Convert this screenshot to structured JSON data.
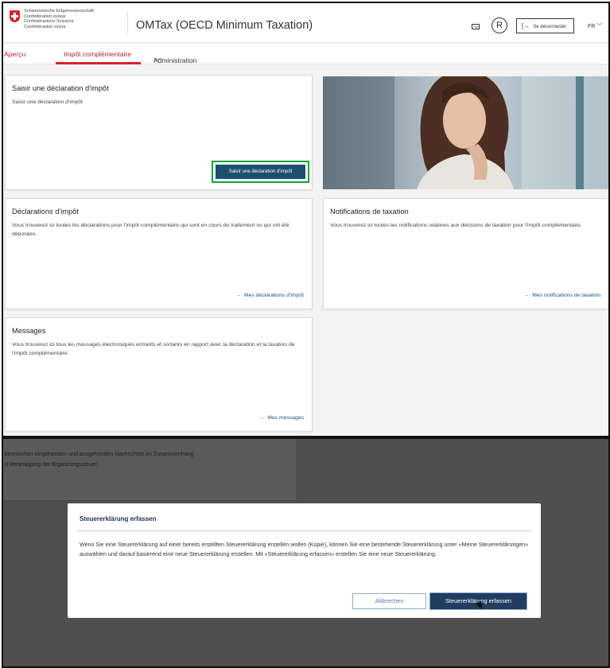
{
  "header": {
    "confederation_lines": [
      "Schweizerische Eidgenossenschaft",
      "Confédération suisse",
      "Confederazione Svizzera",
      "Confederaziun svizra"
    ],
    "app_title": "OMTax (OECD Minimum Taxation)",
    "avatar_letter": "R",
    "login_label": "Se déconnecter",
    "language": "FR"
  },
  "nav": {
    "tabs": [
      {
        "label": "Aperçu"
      },
      {
        "label": "Impôt complémentaire"
      },
      {
        "label": "Administration"
      }
    ]
  },
  "cards": {
    "create": {
      "title": "Saisir une déclaration d'impôt",
      "text": "Saisir une déclaration d'impôt",
      "button": "Saisir une déclaration d'impôt"
    },
    "declarations": {
      "title": "Déclarations d'impôt",
      "text": "Vous trouverez ici toutes les déclarations pour l'impôt complémentaire qui sont en cours de traitement ou qui ont été déposées.",
      "link": "Mes déclarations d'impôt"
    },
    "notifications": {
      "title": "Notifications de taxation",
      "text": "Vous trouverez ici toutes les notifications relatives aux décisions de taxation pour l'impôt complémentaire.",
      "link": "Mes notifications de taxation"
    },
    "messages": {
      "title": "Messages",
      "text": "Vous trouverez ici tous les messages électroniques entrants et sortants en rapport avec la déclaration et la taxation de l'impôt complémentaire.",
      "link": "Mes messages"
    }
  },
  "background_text": {
    "line1": "ktronischen eingehenden und ausgehenden Nachrichten im Zusammenhang",
    "line2": "d Veranlagung der Ergänzungssteuer."
  },
  "dialog": {
    "title": "Steuererklärung erfassen",
    "body": "Wenn Sie eine Steuererklärung auf einer bereits erstellten Steuererklärung erstellen wollen (Kopie), können Sie eine bestehende Steuererklärung unter «Meine Steuererklärungen» auswählen und darauf basierend eine neue Steuererklärung erstellen. Mit «Steuererklärung erfassen» erstellen Sie eine neue Steuererklärung.",
    "cancel": "Abbrechen",
    "confirm": "Steuererklärung erfassen"
  },
  "colors": {
    "brand_red": "#d8232a",
    "primary_blue": "#1d4f6e",
    "highlight_green": "#0fa43a"
  }
}
